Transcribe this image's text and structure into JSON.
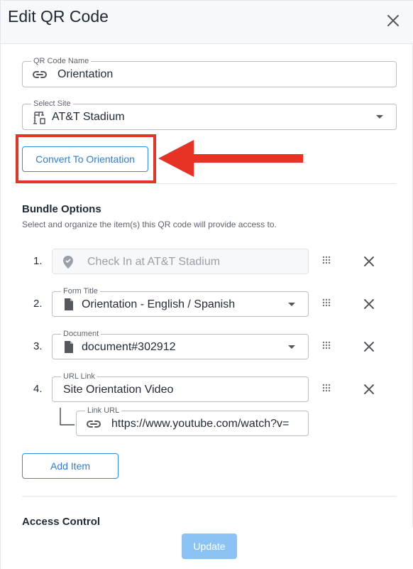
{
  "dialog": {
    "title": "Edit QR Code",
    "close_icon": "close-icon"
  },
  "qr_code_name": {
    "label": "QR Code Name",
    "value": "Orientation",
    "icon": "link-icon"
  },
  "select_site": {
    "label": "Select Site",
    "value": "AT&T Stadium",
    "icon": "crane-icon"
  },
  "convert_button": {
    "label": "Convert To Orientation"
  },
  "bundle_options": {
    "title": "Bundle Options",
    "subtitle": "Select and organize the item(s) this QR code will provide access to.",
    "items": [
      {
        "number": "1.",
        "placeholder": "Check In at AT&T Stadium",
        "icon": "location-check-icon"
      },
      {
        "number": "2.",
        "label": "Form Title",
        "value": "Orientation - English / Spanish",
        "icon": "document-icon"
      },
      {
        "number": "3.",
        "label": "Document",
        "value": "document#302912",
        "icon": "document-icon"
      },
      {
        "number": "4.",
        "label": "URL Link",
        "value": "Site Orientation Video",
        "sub_label": "Link URL",
        "sub_value": "https://www.youtube.com/watch?v=",
        "sub_icon": "link-icon"
      }
    ],
    "add_item_label": "Add Item"
  },
  "access_control": {
    "title": "Access Control"
  },
  "footer": {
    "update_label": "Update"
  },
  "annotation": {
    "highlight_color": "#e63326"
  },
  "colors": {
    "accent": "#2c7fd0",
    "update_disabled": "#8cc3f5",
    "annotation_red": "#e63326"
  }
}
